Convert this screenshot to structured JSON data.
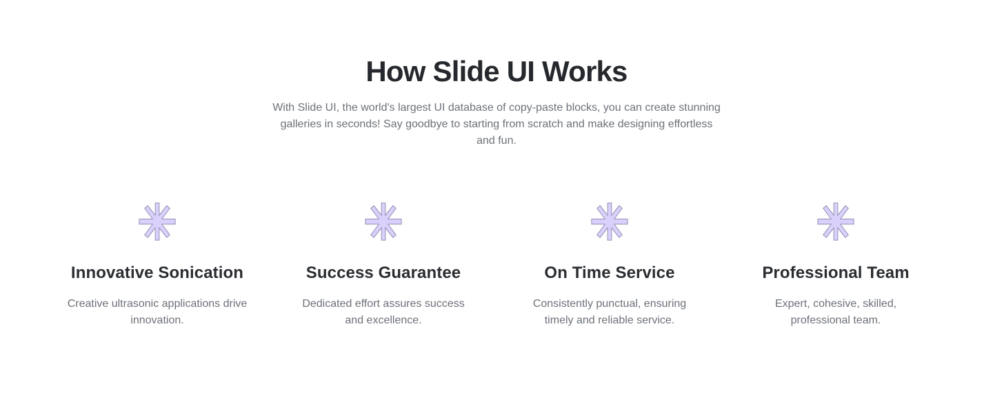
{
  "section": {
    "title": "How Slide UI Works",
    "subtitle": "With Slide UI, the world's largest UI database of copy-paste blocks, you can create stunning galleries in seconds! Say goodbye to starting from scratch and make designing effortless and fun."
  },
  "features": [
    {
      "icon": "asterisk-icon",
      "title": "Innovative Sonication",
      "description": "Creative ultrasonic applications drive innovation."
    },
    {
      "icon": "asterisk-icon",
      "title": "Success Guarantee",
      "description": "Dedicated effort assures success and excellence."
    },
    {
      "icon": "asterisk-icon",
      "title": "On Time Service",
      "description": "Consistently punctual, ensuring timely and reliable service."
    },
    {
      "icon": "asterisk-icon",
      "title": "Professional Team",
      "description": "Expert, cohesive, skilled, professional team."
    }
  ],
  "colors": {
    "icon_fill": "#d9d0fb",
    "icon_stroke": "#8a84a8",
    "heading": "#25282c",
    "body_text": "#6c7178"
  }
}
